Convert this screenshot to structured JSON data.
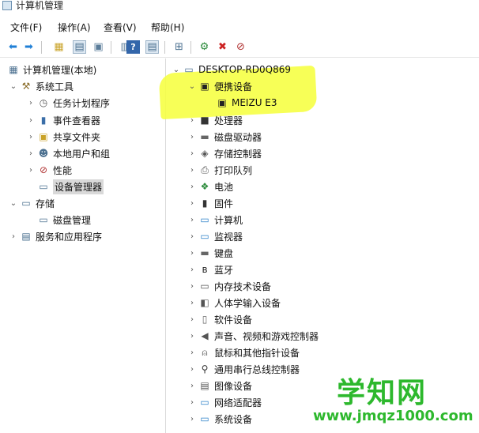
{
  "window": {
    "title": "计算机管理"
  },
  "menu": [
    "文件(F)",
    "操作(A)",
    "查看(V)",
    "帮助(H)"
  ],
  "toolbar": {
    "buttons": [
      "back-icon",
      "forward-icon",
      "folder-up-icon",
      "console-tree-icon",
      "export-list-icon",
      "properties-icon",
      "help-icon",
      "show-pane-icon",
      "update-driver-icon",
      "scan-hardware-icon",
      "disable-device-icon",
      "uninstall-device-icon"
    ]
  },
  "left_tree": {
    "root": "计算机管理(本地)",
    "system_tools": "系统工具",
    "task_scheduler": "任务计划程序",
    "event_viewer": "事件查看器",
    "shared_folders": "共享文件夹",
    "local_users": "本地用户和组",
    "performance": "性能",
    "device_manager": "设备管理器",
    "storage": "存储",
    "disk_management": "磁盘管理",
    "services_apps": "服务和应用程序"
  },
  "device_tree": {
    "computer": "DESKTOP-RD0Q869",
    "portable_devices": "便携设备",
    "portable_child": "MEIZU E3",
    "categories": [
      "处理器",
      "磁盘驱动器",
      "存储控制器",
      "打印队列",
      "电池",
      "固件",
      "计算机",
      "监视器",
      "键盘",
      "蓝牙",
      "内存技术设备",
      "人体学输入设备",
      "软件设备",
      "声音、视频和游戏控制器",
      "鼠标和其他指针设备",
      "通用串行总线控制器",
      "图像设备",
      "网络适配器",
      "系统设备"
    ]
  },
  "watermark": {
    "brand": "学知网",
    "url": "www.jmqz1000.com"
  },
  "colors": {
    "highlight": "#f6ff3a",
    "watermark": "#2db82d",
    "selection": "#d9d9d9"
  }
}
